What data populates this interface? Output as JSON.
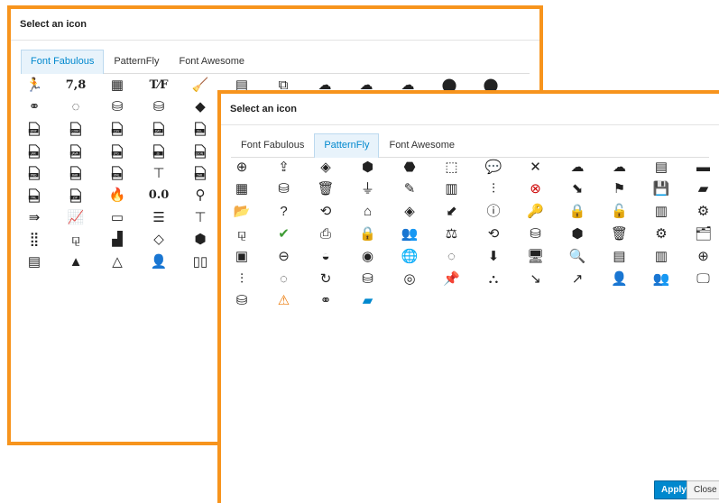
{
  "back_dialog": {
    "title": "Select an icon",
    "tabs": [
      {
        "label": "Font Fabulous",
        "active": true
      },
      {
        "label": "PatternFly",
        "active": false
      },
      {
        "label": "Font Awesome",
        "active": false
      }
    ],
    "icon_rows": [
      [
        {
          "name": "runner-icon",
          "g": "🏃"
        },
        {
          "name": "seven-eight-text-icon",
          "g": "7,8",
          "t": 1
        },
        {
          "name": "grid-blocks-icon",
          "g": "▦"
        },
        {
          "name": "tf-text-icon",
          "g": "T⁄F",
          "t": 1
        },
        {
          "name": "broom-icon",
          "g": "🧹"
        },
        {
          "name": "cabinet-icon",
          "g": "▤"
        },
        {
          "name": "select-square-icon",
          "g": "⧉"
        },
        {
          "name": "cloud-link-icon",
          "g": "☁"
        },
        {
          "name": "cloud-grid-icon",
          "g": "☁"
        },
        {
          "name": "cloud-share-icon",
          "g": "☁"
        },
        {
          "name": "circles-overlap-icon",
          "g": "⬤"
        },
        {
          "name": "circles-overlap-2-icon",
          "g": "⬤"
        }
      ],
      [
        {
          "name": "venn-outline-icon",
          "g": "⚭"
        },
        {
          "name": "network-ring-icon",
          "g": "◌"
        },
        {
          "name": "database-config-icon",
          "g": "⛁"
        },
        {
          "name": "database-icon",
          "g": "⛁"
        },
        {
          "name": "diamond-icon",
          "g": "◆"
        }
      ],
      [
        {
          "name": "bmp-file-icon",
          "g": "BMP",
          "f": 1
        },
        {
          "name": "com-file-icon",
          "g": "COM",
          "f": 1
        },
        {
          "name": "csv-file-icon",
          "g": "CSV",
          "f": 1
        },
        {
          "name": "dat-file-icon",
          "g": "DAT",
          "f": 1
        },
        {
          "name": "dll-file-icon",
          "g": "DLL",
          "f": 1
        }
      ],
      [
        {
          "name": "jar-file-icon",
          "g": "JAR",
          "f": 1
        },
        {
          "name": "java-file-icon",
          "g": "JAVA",
          "f": 1
        },
        {
          "name": "jpg-file-icon",
          "g": "JPG",
          "f": 1
        },
        {
          "name": "js-file-icon",
          "g": "JS",
          "f": 1
        },
        {
          "name": "json-file-icon",
          "g": "JSON",
          "f": 1
        }
      ],
      [
        {
          "name": "pnd-file-icon",
          "g": "PND",
          "f": 1
        },
        {
          "name": "rar-file-icon",
          "g": "RAR",
          "f": 1
        },
        {
          "name": "xml-file-icon",
          "g": "XML",
          "f": 1
        },
        {
          "name": "t-shape-icon",
          "g": "⊤"
        },
        {
          "name": "tar-file-icon",
          "g": "TAR",
          "f": 1
        }
      ],
      [
        {
          "name": "yml-file-icon",
          "g": "YML",
          "f": 1
        },
        {
          "name": "zip-file-icon",
          "g": "ZIP",
          "f": 1
        },
        {
          "name": "firewall-icon",
          "g": "🔥"
        },
        {
          "name": "zero-zero-text-icon",
          "g": "0.0",
          "t": 1
        },
        {
          "name": "map-pin-icon",
          "g": "⚲"
        }
      ],
      [
        {
          "name": "arrow-diamond-icon",
          "g": "⇛"
        },
        {
          "name": "line-chart-icon",
          "g": "📈"
        },
        {
          "name": "progress-box-icon",
          "g": "▭"
        },
        {
          "name": "server-rack-icon",
          "g": "☰"
        },
        {
          "name": "t-bar-icon",
          "g": "⊤"
        }
      ],
      [
        {
          "name": "dots-grid-icon",
          "g": "⣿"
        },
        {
          "name": "hierarchy-icon",
          "g": "⚼"
        },
        {
          "name": "bar-steps-icon",
          "g": "▟"
        },
        {
          "name": "diamond-arrow-icon",
          "g": "◇"
        },
        {
          "name": "box-open-icon",
          "g": "⬢"
        }
      ],
      [
        {
          "name": "bar-chart-flat-icon",
          "g": "▤"
        },
        {
          "name": "triangle-filled-icon",
          "g": "▲"
        },
        {
          "name": "triangle-outline-icon",
          "g": "△"
        },
        {
          "name": "user-lock-icon",
          "g": "👤"
        },
        {
          "name": "double-column-icon",
          "g": "▯▯"
        }
      ]
    ]
  },
  "front_dialog": {
    "title": "Select an icon",
    "tabs": [
      {
        "label": "Font Fabulous",
        "active": false
      },
      {
        "label": "PatternFly",
        "active": true
      },
      {
        "label": "Font Awesome",
        "active": false
      }
    ],
    "icon_rows": [
      [
        {
          "name": "plus-circle-icon",
          "g": "⊕"
        },
        {
          "name": "share-export-icon",
          "g": "⇪"
        },
        {
          "name": "layers-icon",
          "g": "◈"
        },
        {
          "name": "bundle-icon",
          "g": "⬢"
        },
        {
          "name": "cubes-icon",
          "g": "⬣"
        },
        {
          "name": "dashed-box-icon",
          "g": "⬚"
        },
        {
          "name": "chat-export-icon",
          "g": "💬"
        },
        {
          "name": "close-x-icon",
          "g": "✕"
        },
        {
          "name": "cloud-security-icon",
          "g": "☁"
        },
        {
          "name": "cloud-tenant-icon",
          "g": "☁"
        },
        {
          "name": "server-stack-icon",
          "g": "▤"
        },
        {
          "name": "drive-icon",
          "g": "▬"
        }
      ],
      [
        {
          "name": "cpu-icon",
          "g": "▦"
        },
        {
          "name": "storage-error-icon",
          "g": "⛁"
        },
        {
          "name": "trash-icon",
          "g": "🗑"
        },
        {
          "name": "plugged-icon",
          "g": "⏚"
        },
        {
          "name": "edit-pencil-icon",
          "g": "✎"
        },
        {
          "name": "enterprise-icon",
          "g": "▥"
        },
        {
          "name": "equalizer-icon",
          "g": "⫶"
        },
        {
          "name": "error-circle-icon",
          "g": "⊗",
          "c": "#cc0000"
        },
        {
          "name": "export-arrow-icon",
          "g": "⬊"
        },
        {
          "name": "flag-icon",
          "g": "⚑"
        },
        {
          "name": "save-floppy-icon",
          "g": "💾"
        },
        {
          "name": "folder-closed-icon",
          "g": "▰"
        }
      ],
      [
        {
          "name": "folder-open-icon",
          "g": "📂"
        },
        {
          "name": "help-circle-icon",
          "g": "?"
        },
        {
          "name": "history-icon",
          "g": "⟲"
        },
        {
          "name": "home-icon",
          "g": "⌂"
        },
        {
          "name": "image-layers-icon",
          "g": "◈"
        },
        {
          "name": "import-icon",
          "g": "⬋"
        },
        {
          "name": "info-circle-icon",
          "g": "ⓘ"
        },
        {
          "name": "key-icon",
          "g": "🔑"
        },
        {
          "name": "lock-locked-icon",
          "g": "🔒"
        },
        {
          "name": "lock-unlocked-icon",
          "g": "🔓"
        },
        {
          "name": "memory-icon",
          "g": "▥"
        },
        {
          "name": "middleware-icon",
          "g": "⚙"
        }
      ],
      [
        {
          "name": "network-icon",
          "g": "⚼"
        },
        {
          "name": "ok-check-icon",
          "g": "✔",
          "c": "#3f9c35"
        },
        {
          "name": "print-icon",
          "g": "⎙"
        },
        {
          "name": "private-lock-icon",
          "g": "🔒"
        },
        {
          "name": "users-group-icon",
          "g": "👥"
        },
        {
          "name": "scales-icon",
          "g": "⚖"
        },
        {
          "name": "restart-icon",
          "g": "⟲"
        },
        {
          "name": "database-storage-icon",
          "g": "⛁"
        },
        {
          "name": "volume-boxes-icon",
          "g": "⬢"
        },
        {
          "name": "trash-bin-icon",
          "g": "🗑"
        },
        {
          "name": "cogs-icon",
          "g": "⚙"
        },
        {
          "name": "folder-tree-icon",
          "g": "🗂"
        }
      ],
      [
        {
          "name": "chip-icon",
          "g": "▣"
        },
        {
          "name": "minus-circle-icon",
          "g": "⊖"
        },
        {
          "name": "half-circle-icon",
          "g": "◒"
        },
        {
          "name": "record-circle-icon",
          "g": "◉"
        },
        {
          "name": "globe-icon",
          "g": "🌐"
        },
        {
          "name": "spinner-icon",
          "g": "◌"
        },
        {
          "name": "download-box-icon",
          "g": "⬇"
        },
        {
          "name": "monitor-icon",
          "g": "🖥"
        },
        {
          "name": "search-icon",
          "g": "🔍"
        },
        {
          "name": "server-icon",
          "g": "▤"
        },
        {
          "name": "service-icon",
          "g": "▥"
        },
        {
          "name": "service-catalog-icon",
          "g": "⊕"
        }
      ],
      [
        {
          "name": "sliders-icon",
          "g": "⫶"
        },
        {
          "name": "spinner-2-icon",
          "g": "◌"
        },
        {
          "name": "refresh-icon",
          "g": "↻"
        },
        {
          "name": "storage-search-icon",
          "g": "⛁"
        },
        {
          "name": "cluster-circle-icon",
          "g": "◎"
        },
        {
          "name": "thumbtack-icon",
          "g": "📌"
        },
        {
          "name": "topology-icon",
          "g": "⛬"
        },
        {
          "name": "trend-down-icon",
          "g": "↘"
        },
        {
          "name": "trend-up-icon",
          "g": "↗"
        },
        {
          "name": "user-icon",
          "g": "👤"
        },
        {
          "name": "users-icon",
          "g": "👥"
        },
        {
          "name": "virtual-machine-icon",
          "g": "🖵"
        }
      ],
      [
        {
          "name": "database-stack-icon",
          "g": "⛁"
        },
        {
          "name": "warning-triangle-icon",
          "g": "⚠",
          "c": "#ec7a08"
        },
        {
          "name": "zones-venn-icon",
          "g": "⚭"
        },
        {
          "name": "blue-folder-icon",
          "g": "▰",
          "c": "#0088ce"
        }
      ]
    ],
    "apply_label": "Apply",
    "close_label": "Close"
  }
}
